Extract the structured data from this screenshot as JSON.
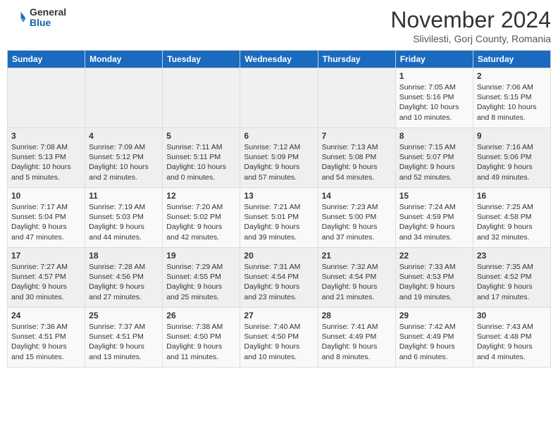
{
  "header": {
    "logo_general": "General",
    "logo_blue": "Blue",
    "month_title": "November 2024",
    "subtitle": "Slivilesti, Gorj County, Romania"
  },
  "days_of_week": [
    "Sunday",
    "Monday",
    "Tuesday",
    "Wednesday",
    "Thursday",
    "Friday",
    "Saturday"
  ],
  "weeks": [
    [
      {
        "day": "",
        "info": ""
      },
      {
        "day": "",
        "info": ""
      },
      {
        "day": "",
        "info": ""
      },
      {
        "day": "",
        "info": ""
      },
      {
        "day": "",
        "info": ""
      },
      {
        "day": "1",
        "info": "Sunrise: 7:05 AM\nSunset: 5:16 PM\nDaylight: 10 hours and 10 minutes."
      },
      {
        "day": "2",
        "info": "Sunrise: 7:06 AM\nSunset: 5:15 PM\nDaylight: 10 hours and 8 minutes."
      }
    ],
    [
      {
        "day": "3",
        "info": "Sunrise: 7:08 AM\nSunset: 5:13 PM\nDaylight: 10 hours and 5 minutes."
      },
      {
        "day": "4",
        "info": "Sunrise: 7:09 AM\nSunset: 5:12 PM\nDaylight: 10 hours and 2 minutes."
      },
      {
        "day": "5",
        "info": "Sunrise: 7:11 AM\nSunset: 5:11 PM\nDaylight: 10 hours and 0 minutes."
      },
      {
        "day": "6",
        "info": "Sunrise: 7:12 AM\nSunset: 5:09 PM\nDaylight: 9 hours and 57 minutes."
      },
      {
        "day": "7",
        "info": "Sunrise: 7:13 AM\nSunset: 5:08 PM\nDaylight: 9 hours and 54 minutes."
      },
      {
        "day": "8",
        "info": "Sunrise: 7:15 AM\nSunset: 5:07 PM\nDaylight: 9 hours and 52 minutes."
      },
      {
        "day": "9",
        "info": "Sunrise: 7:16 AM\nSunset: 5:06 PM\nDaylight: 9 hours and 49 minutes."
      }
    ],
    [
      {
        "day": "10",
        "info": "Sunrise: 7:17 AM\nSunset: 5:04 PM\nDaylight: 9 hours and 47 minutes."
      },
      {
        "day": "11",
        "info": "Sunrise: 7:19 AM\nSunset: 5:03 PM\nDaylight: 9 hours and 44 minutes."
      },
      {
        "day": "12",
        "info": "Sunrise: 7:20 AM\nSunset: 5:02 PM\nDaylight: 9 hours and 42 minutes."
      },
      {
        "day": "13",
        "info": "Sunrise: 7:21 AM\nSunset: 5:01 PM\nDaylight: 9 hours and 39 minutes."
      },
      {
        "day": "14",
        "info": "Sunrise: 7:23 AM\nSunset: 5:00 PM\nDaylight: 9 hours and 37 minutes."
      },
      {
        "day": "15",
        "info": "Sunrise: 7:24 AM\nSunset: 4:59 PM\nDaylight: 9 hours and 34 minutes."
      },
      {
        "day": "16",
        "info": "Sunrise: 7:25 AM\nSunset: 4:58 PM\nDaylight: 9 hours and 32 minutes."
      }
    ],
    [
      {
        "day": "17",
        "info": "Sunrise: 7:27 AM\nSunset: 4:57 PM\nDaylight: 9 hours and 30 minutes."
      },
      {
        "day": "18",
        "info": "Sunrise: 7:28 AM\nSunset: 4:56 PM\nDaylight: 9 hours and 27 minutes."
      },
      {
        "day": "19",
        "info": "Sunrise: 7:29 AM\nSunset: 4:55 PM\nDaylight: 9 hours and 25 minutes."
      },
      {
        "day": "20",
        "info": "Sunrise: 7:31 AM\nSunset: 4:54 PM\nDaylight: 9 hours and 23 minutes."
      },
      {
        "day": "21",
        "info": "Sunrise: 7:32 AM\nSunset: 4:54 PM\nDaylight: 9 hours and 21 minutes."
      },
      {
        "day": "22",
        "info": "Sunrise: 7:33 AM\nSunset: 4:53 PM\nDaylight: 9 hours and 19 minutes."
      },
      {
        "day": "23",
        "info": "Sunrise: 7:35 AM\nSunset: 4:52 PM\nDaylight: 9 hours and 17 minutes."
      }
    ],
    [
      {
        "day": "24",
        "info": "Sunrise: 7:36 AM\nSunset: 4:51 PM\nDaylight: 9 hours and 15 minutes."
      },
      {
        "day": "25",
        "info": "Sunrise: 7:37 AM\nSunset: 4:51 PM\nDaylight: 9 hours and 13 minutes."
      },
      {
        "day": "26",
        "info": "Sunrise: 7:38 AM\nSunset: 4:50 PM\nDaylight: 9 hours and 11 minutes."
      },
      {
        "day": "27",
        "info": "Sunrise: 7:40 AM\nSunset: 4:50 PM\nDaylight: 9 hours and 10 minutes."
      },
      {
        "day": "28",
        "info": "Sunrise: 7:41 AM\nSunset: 4:49 PM\nDaylight: 9 hours and 8 minutes."
      },
      {
        "day": "29",
        "info": "Sunrise: 7:42 AM\nSunset: 4:49 PM\nDaylight: 9 hours and 6 minutes."
      },
      {
        "day": "30",
        "info": "Sunrise: 7:43 AM\nSunset: 4:48 PM\nDaylight: 9 hours and 4 minutes."
      }
    ]
  ]
}
